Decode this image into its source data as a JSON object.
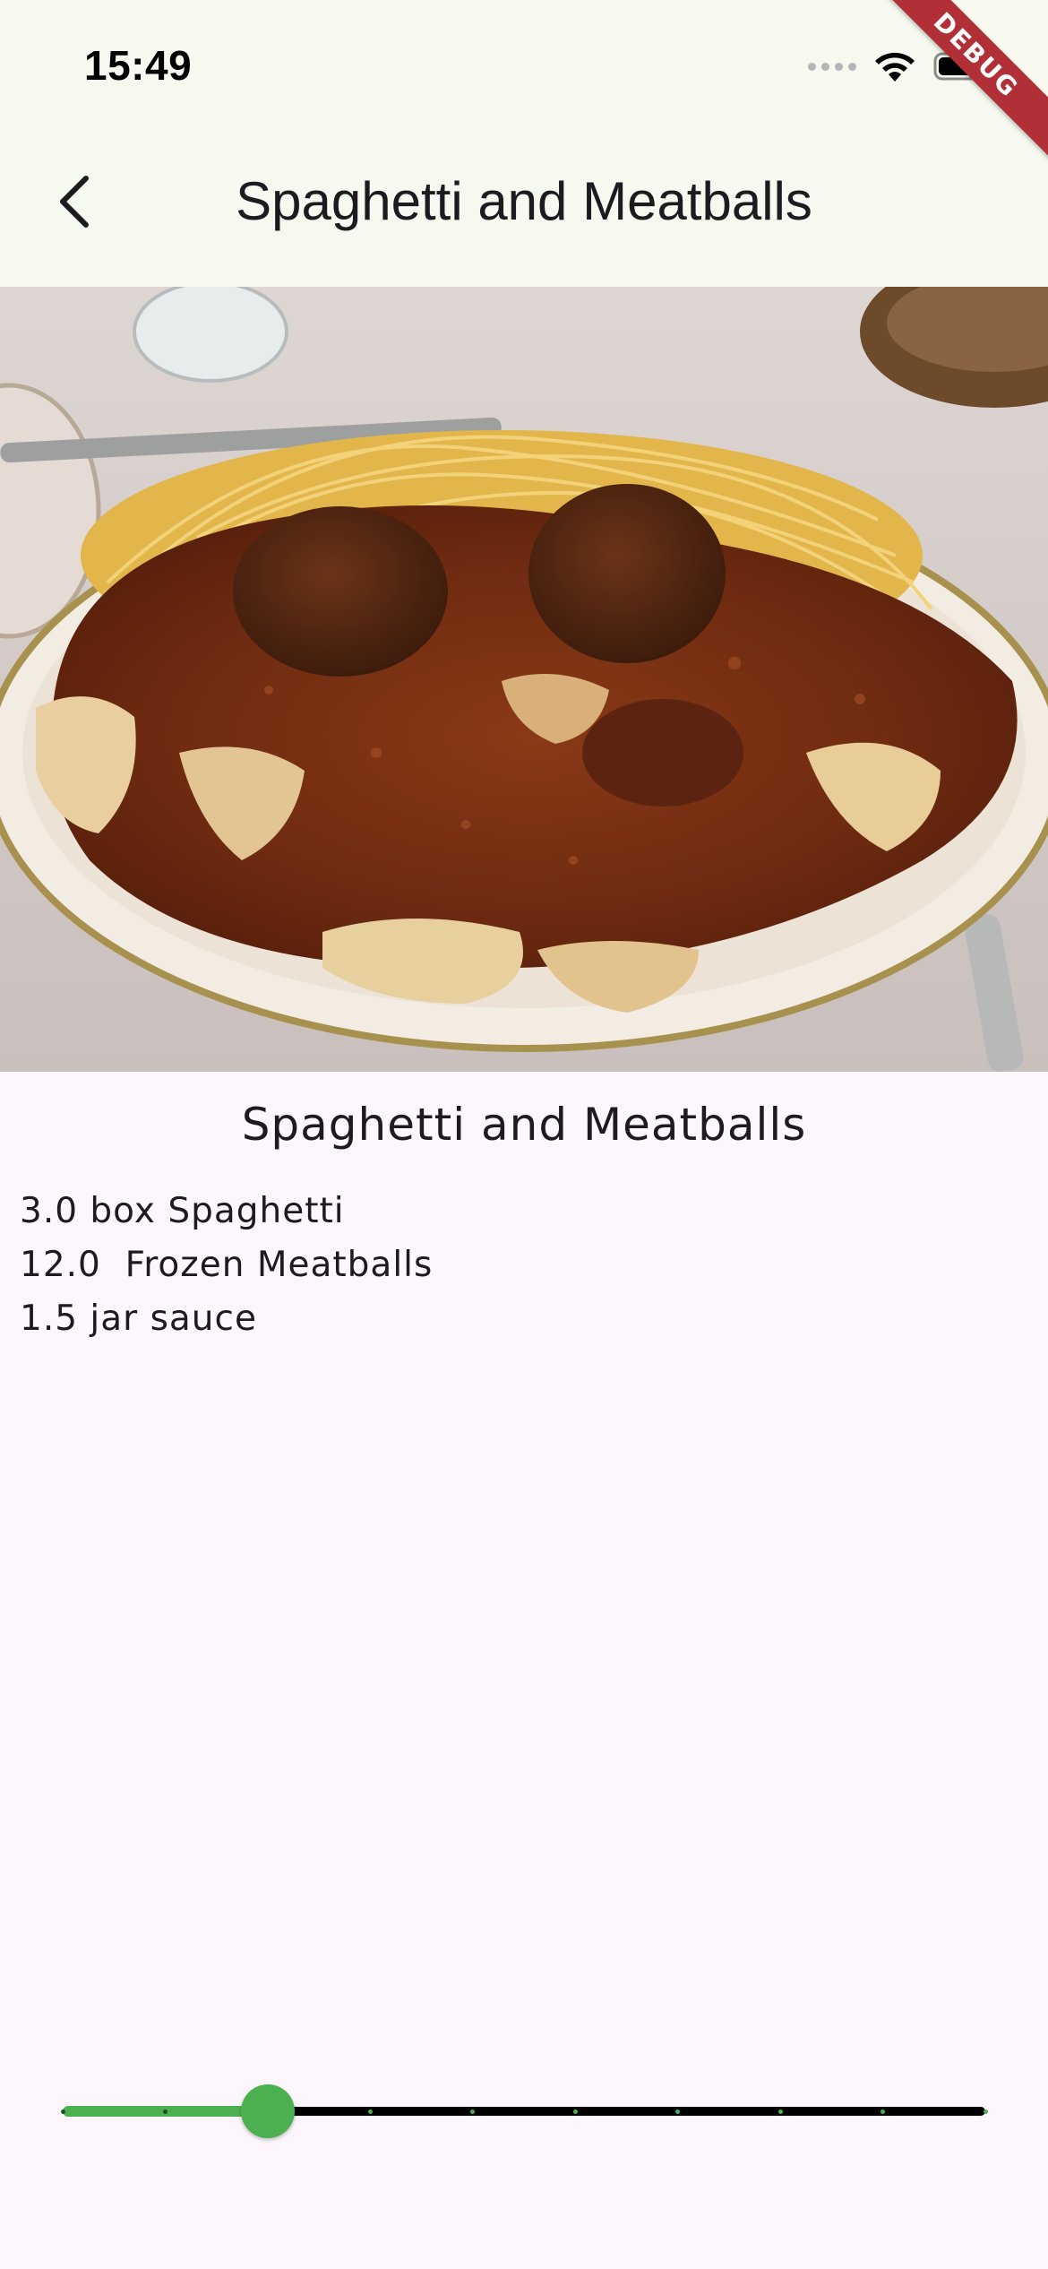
{
  "status_bar": {
    "time": "15:49",
    "icons": [
      "cellular-signal-icon",
      "wifi-icon",
      "battery-icon"
    ]
  },
  "debug_banner": "DEBUG",
  "app_bar": {
    "back_icon": "chevron-left-icon",
    "title": "Spaghetti and Meatballs"
  },
  "recipe": {
    "title": "Spaghetti and Meatballs",
    "ingredients": [
      "3.0 box Spaghetti",
      "12.0  Frozen Meatballs",
      "1.5 jar sauce"
    ]
  },
  "servings_slider": {
    "value": 3,
    "min": 1,
    "max": 10,
    "divisions": 9,
    "active_color": "#4caf50",
    "inactive_color": "#000000"
  },
  "colors": {
    "app_bar_bg": "#f5f9ef",
    "page_bg": "#fdf7fd",
    "debug_ribbon": "#b13037"
  }
}
